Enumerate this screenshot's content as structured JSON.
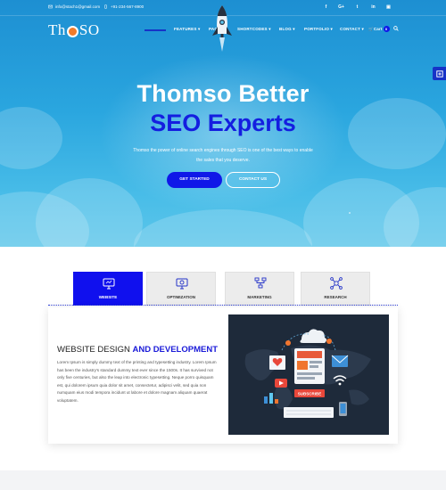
{
  "topbar": {
    "email": "info@stach1@gmail.com",
    "phone": "+91-234-567-8900",
    "social": [
      "f",
      "G+",
      "t",
      "in",
      "▣"
    ]
  },
  "logo": {
    "left": "Th",
    "right": "SO"
  },
  "nav": {
    "items": [
      "",
      "FEATURES ▾",
      "PAGES ▾",
      "SHORTCODES ▾",
      "BLOG ▾",
      "PORTFOLIO ▾",
      "CONTACT ▾"
    ],
    "cart_label": "Cart",
    "cart_count": "0"
  },
  "hero": {
    "title_line1": "Thomso Better",
    "title_line2": "SEO Experts",
    "subtitle": "Thomso the power of online search engines through SEO is one of the best ways to enable the sales that you deserve.",
    "primary_button": "GET STARTED",
    "secondary_button": "CONTACT US"
  },
  "tabs": [
    {
      "label": "WEBSITE",
      "icon": "monitor-icon"
    },
    {
      "label": "OPTIMIZATION",
      "icon": "monitor-gear-icon"
    },
    {
      "label": "MARKETING",
      "icon": "network-icon"
    },
    {
      "label": "RESEARCH",
      "icon": "nodes-icon"
    }
  ],
  "content": {
    "title_normal": "WEBSITE DESIGN",
    "title_accent": "AND DEVELOPMENT",
    "body": "Lorem Ipsum is simply dummy text of the printing and typesetting industry. Lorem Ipsum has been the industry's standard dummy text ever since the 1500s. It has survived not only five centuries, but also the leap into electronic typesetting. Neque porro quisquam est, qui dolorem ipsum quia dolor sit amet, consectetur, adipisci velit, sed quia non numquam eius modi tempora incidunt ut labore et dolore magnam aliquam quaerat voluptatem."
  },
  "colors": {
    "accent": "#1010ee",
    "hero_top": "#1d8fd2",
    "hero_bottom": "#5cc6ea"
  }
}
